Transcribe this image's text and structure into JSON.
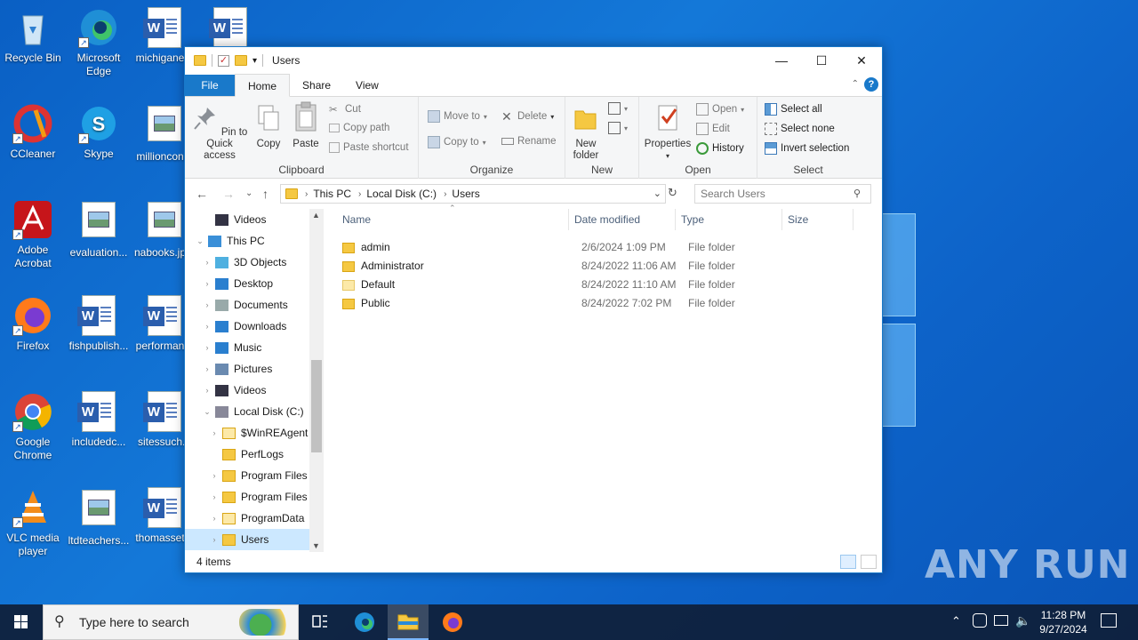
{
  "desktop": {
    "icons": [
      {
        "label": "Recycle Bin",
        "type": "recycle"
      },
      {
        "label": "Microsoft Edge",
        "type": "edge"
      },
      {
        "label": "michigane...",
        "type": "word"
      },
      {
        "label": "",
        "type": "word"
      },
      {
        "label": "CCleaner",
        "type": "ccleaner"
      },
      {
        "label": "Skype",
        "type": "skype"
      },
      {
        "label": "millioncon...",
        "type": "image"
      },
      {
        "label": "Adobe Acrobat",
        "type": "acrobat"
      },
      {
        "label": "evaluation...",
        "type": "image"
      },
      {
        "label": "nabooks.jp...",
        "type": "image"
      },
      {
        "label": "Firefox",
        "type": "firefox"
      },
      {
        "label": "fishpublish...",
        "type": "word"
      },
      {
        "label": "performan...",
        "type": "word"
      },
      {
        "label": "Google Chrome",
        "type": "chrome"
      },
      {
        "label": "includedc...",
        "type": "word"
      },
      {
        "label": "sitessuch...",
        "type": "word"
      },
      {
        "label": "VLC media player",
        "type": "vlc"
      },
      {
        "label": "ltdteachers...",
        "type": "image"
      },
      {
        "label": "thomasset...",
        "type": "word"
      }
    ],
    "watermark": "ANY RUN"
  },
  "window": {
    "title": "Users",
    "controls": {
      "minimize": "—",
      "maximize": "☐",
      "close": "✕"
    },
    "tabs": [
      {
        "label": "File"
      },
      {
        "label": "Home"
      },
      {
        "label": "Share"
      },
      {
        "label": "View"
      }
    ],
    "help": "?",
    "ribbon": {
      "clipboard": {
        "label": "Clipboard",
        "pin": "Pin to Quick access",
        "copy": "Copy",
        "paste": "Paste",
        "cut": "Cut",
        "copy_path": "Copy path",
        "paste_shortcut": "Paste shortcut"
      },
      "organize": {
        "label": "Organize",
        "move_to": "Move to",
        "copy_to": "Copy to",
        "delete": "Delete",
        "rename": "Rename"
      },
      "new": {
        "label": "New",
        "new_folder": "New folder"
      },
      "open": {
        "label": "Open",
        "properties": "Properties",
        "open": "Open",
        "edit": "Edit",
        "history": "History"
      },
      "select": {
        "label": "Select",
        "select_all": "Select all",
        "select_none": "Select none",
        "invert": "Invert selection"
      }
    },
    "address": {
      "crumbs": [
        "This PC",
        "Local Disk (C:)",
        "Users"
      ],
      "search_placeholder": "Search Users"
    },
    "nav": [
      {
        "label": "Videos",
        "indent": 1,
        "icon": "videos",
        "expander": ""
      },
      {
        "label": "This PC",
        "indent": 0,
        "icon": "pc",
        "expander": "⌄"
      },
      {
        "label": "3D Objects",
        "indent": 1,
        "icon": "3d",
        "expander": "›"
      },
      {
        "label": "Desktop",
        "indent": 1,
        "icon": "desktop",
        "expander": "›"
      },
      {
        "label": "Documents",
        "indent": 1,
        "icon": "documents",
        "expander": "›"
      },
      {
        "label": "Downloads",
        "indent": 1,
        "icon": "downloads",
        "expander": "›"
      },
      {
        "label": "Music",
        "indent": 1,
        "icon": "music",
        "expander": "›"
      },
      {
        "label": "Pictures",
        "indent": 1,
        "icon": "pictures",
        "expander": "›"
      },
      {
        "label": "Videos",
        "indent": 1,
        "icon": "videos",
        "expander": "›"
      },
      {
        "label": "Local Disk (C:)",
        "indent": 1,
        "icon": "disk",
        "expander": "⌄"
      },
      {
        "label": "$WinREAgent",
        "indent": 2,
        "icon": "folder-light",
        "expander": "›"
      },
      {
        "label": "PerfLogs",
        "indent": 2,
        "icon": "folder",
        "expander": ""
      },
      {
        "label": "Program Files",
        "indent": 2,
        "icon": "folder",
        "expander": "›"
      },
      {
        "label": "Program Files",
        "indent": 2,
        "icon": "folder",
        "expander": "›"
      },
      {
        "label": "ProgramData",
        "indent": 2,
        "icon": "folder-light",
        "expander": "›"
      },
      {
        "label": "Users",
        "indent": 2,
        "icon": "folder",
        "expander": "›",
        "selected": true
      }
    ],
    "columns": {
      "name": "Name",
      "date": "Date modified",
      "type": "Type",
      "size": "Size"
    },
    "files": [
      {
        "name": "admin",
        "date": "2/6/2024 1:09 PM",
        "type": "File folder",
        "light": false
      },
      {
        "name": "Administrator",
        "date": "8/24/2022 11:06 AM",
        "type": "File folder",
        "light": false
      },
      {
        "name": "Default",
        "date": "8/24/2022 11:10 AM",
        "type": "File folder",
        "light": true
      },
      {
        "name": "Public",
        "date": "8/24/2022 7:02 PM",
        "type": "File folder",
        "light": false
      }
    ],
    "status": "4 items"
  },
  "taskbar": {
    "search_placeholder": "Type here to search",
    "time": "11:28 PM",
    "date": "9/27/2024"
  }
}
